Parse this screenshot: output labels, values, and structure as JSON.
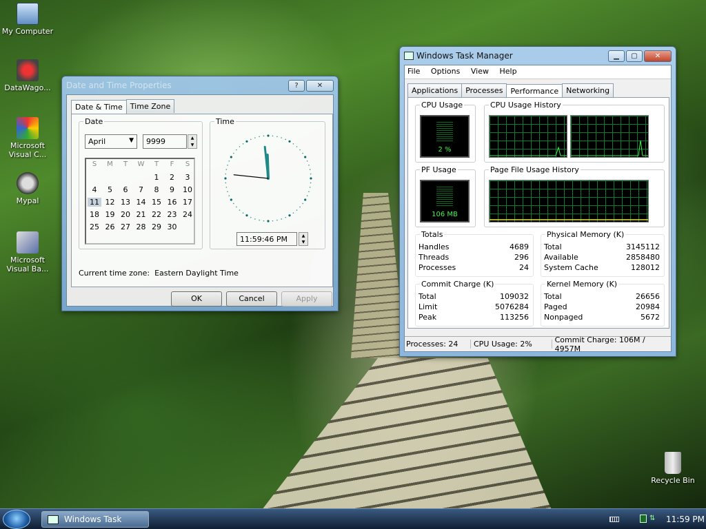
{
  "desktop": {
    "icons": [
      {
        "label": "My Computer",
        "icon": "computer-icon"
      },
      {
        "label": "DataWago...",
        "icon": "shortcut-icon"
      },
      {
        "label": "Microsoft Visual C...",
        "icon": "visual-c-icon"
      },
      {
        "label": "Mypal",
        "icon": "mypal-icon"
      },
      {
        "label": "Microsoft Visual Ba...",
        "icon": "visual-basic-icon"
      },
      {
        "label": "Recycle Bin",
        "icon": "recycle-bin-icon"
      }
    ]
  },
  "datetime": {
    "title": "Date and Time Properties",
    "help": "?",
    "close": "✕",
    "tabs": [
      "Date & Time",
      "Time Zone"
    ],
    "date_group": "Date",
    "month": "April",
    "year": "9999",
    "weekdays": [
      "S",
      "M",
      "T",
      "W",
      "T",
      "F",
      "S"
    ],
    "weeks": [
      [
        "",
        "",
        "",
        "",
        "1",
        "2",
        "3"
      ],
      [
        "4",
        "5",
        "6",
        "7",
        "8",
        "9",
        "10"
      ],
      [
        "11",
        "12",
        "13",
        "14",
        "15",
        "16",
        "17"
      ],
      [
        "18",
        "19",
        "20",
        "21",
        "22",
        "23",
        "24"
      ],
      [
        "25",
        "26",
        "27",
        "28",
        "29",
        "30",
        ""
      ]
    ],
    "selected_day": "11",
    "time_group": "Time",
    "time_value": "11:59:46 PM",
    "timezone_label": "Current time zone:",
    "timezone_value": "Eastern Daylight Time",
    "ok": "OK",
    "cancel": "Cancel",
    "apply": "Apply"
  },
  "taskmgr": {
    "title": "Windows Task Manager",
    "menu": [
      "File",
      "Options",
      "View",
      "Help"
    ],
    "tabs": [
      "Applications",
      "Processes",
      "Performance",
      "Networking"
    ],
    "active_tab": "Performance",
    "cpu_usage_label": "CPU Usage",
    "cpu_usage_value": "2 %",
    "cpu_history_label": "CPU Usage History",
    "pf_usage_label": "PF Usage",
    "pf_usage_value": "106 MB",
    "pf_history_label": "Page File Usage History",
    "totals": {
      "label": "Totals",
      "rows": [
        [
          "Handles",
          "4689"
        ],
        [
          "Threads",
          "296"
        ],
        [
          "Processes",
          "24"
        ]
      ]
    },
    "physical": {
      "label": "Physical Memory (K)",
      "rows": [
        [
          "Total",
          "3145112"
        ],
        [
          "Available",
          "2858480"
        ],
        [
          "System Cache",
          "128012"
        ]
      ]
    },
    "commit": {
      "label": "Commit Charge (K)",
      "rows": [
        [
          "Total",
          "109032"
        ],
        [
          "Limit",
          "5076284"
        ],
        [
          "Peak",
          "113256"
        ]
      ]
    },
    "kernel": {
      "label": "Kernel Memory (K)",
      "rows": [
        [
          "Total",
          "26656"
        ],
        [
          "Paged",
          "20984"
        ],
        [
          "Nonpaged",
          "5672"
        ]
      ]
    },
    "status": {
      "processes": "Processes: 24",
      "cpu": "CPU Usage: 2%",
      "commit": "Commit Charge: 106M / 4957M"
    }
  },
  "taskbar": {
    "item": "Windows Task Man...",
    "clock": "11:59 PM"
  }
}
